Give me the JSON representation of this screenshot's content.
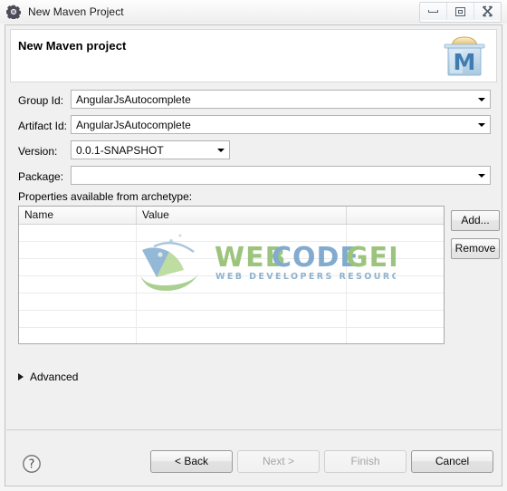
{
  "window": {
    "title": "New Maven Project",
    "icon": "maven-gear-icon",
    "controls": {
      "minimize": "minimize-icon",
      "maximize": "restore-icon",
      "close": "close-icon"
    }
  },
  "banner": {
    "title": "New Maven project",
    "logo": "maven-logo-icon",
    "logo_letter": "M"
  },
  "form": {
    "fields": [
      {
        "label": "Group Id:",
        "value": "AngularJsAutocomplete",
        "width": "wide",
        "name": "group-id"
      },
      {
        "label": "Artifact Id:",
        "value": "AngularJsAutocomplete",
        "width": "wide",
        "name": "artifact-id"
      },
      {
        "label": "Version:",
        "value": "0.0.1-SNAPSHOT",
        "width": "narrow",
        "name": "version"
      },
      {
        "label": "Package:",
        "value": "",
        "width": "wide",
        "name": "package"
      }
    ]
  },
  "properties": {
    "section_label": "Properties available from archetype:",
    "columns": [
      "Name",
      "Value",
      ""
    ],
    "rows": [],
    "row_count": 7,
    "buttons": {
      "add": "Add...",
      "remove": "Remove"
    }
  },
  "watermark": {
    "title": "WEB CODE GEEKS",
    "subtitle": "WEB DEVELOPERS RESOURCE CENTER"
  },
  "advanced": {
    "label": "Advanced",
    "expanded": false
  },
  "footer": {
    "help": "help-icon",
    "buttons": [
      {
        "label": "< Back",
        "enabled": true,
        "name": "back-button"
      },
      {
        "label": "Next >",
        "enabled": false,
        "name": "next-button"
      },
      {
        "label": "Finish",
        "enabled": false,
        "name": "finish-button"
      },
      {
        "label": "Cancel",
        "enabled": true,
        "name": "cancel-button"
      }
    ]
  },
  "colors": {
    "dialog_bg": "#f0f0f0",
    "banner_bg": "#ffffff",
    "field_bg": "#ffffff",
    "border": "#b4b4b4",
    "maven_blue": "#5b9bd5",
    "watermark_green": "#8fbc6a",
    "watermark_blue": "#6f9fc8"
  }
}
